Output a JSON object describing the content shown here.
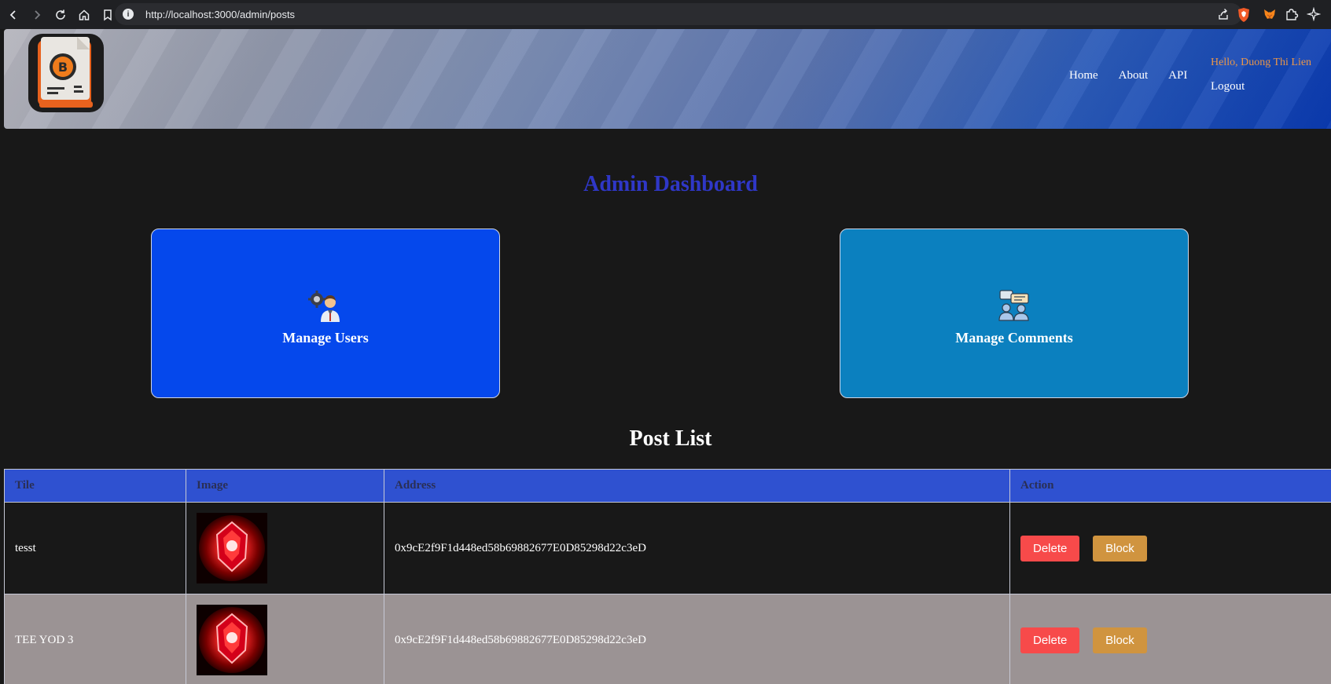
{
  "browser": {
    "url": "http://localhost:3000/admin/posts",
    "info_glyph": "i"
  },
  "header": {
    "nav": [
      "Home",
      "About",
      "API"
    ],
    "greeting": "Hello, Duong Thi Lien",
    "logout": "Logout"
  },
  "dashboard": {
    "title": "Admin Dashboard",
    "cards": [
      {
        "label": "Manage Users",
        "icon": "user-settings-icon"
      },
      {
        "label": "Manage Comments",
        "icon": "users-chat-icon"
      }
    ]
  },
  "posts": {
    "title": "Post List",
    "columns": [
      "Tile",
      "Image",
      "Address",
      "Action"
    ],
    "rows": [
      {
        "title": "tesst",
        "address": "0x9cE2f9F1d448ed58b69882677E0D85298d22c3eD"
      },
      {
        "title": "TEE YOD 3",
        "address": "0x9cE2f9F1d448ed58b69882677E0D85298d22c3eD"
      }
    ],
    "delete_label": "Delete",
    "block_label": "Block"
  },
  "colors": {
    "dashboard_title": "#2f37c7",
    "users_card": "#0548ec",
    "comments_card": "#0b80bf",
    "table_header": "#2f51d0",
    "delete_button": "#f74a4a",
    "block_button": "#d0943f",
    "greeting": "#e9964a"
  }
}
